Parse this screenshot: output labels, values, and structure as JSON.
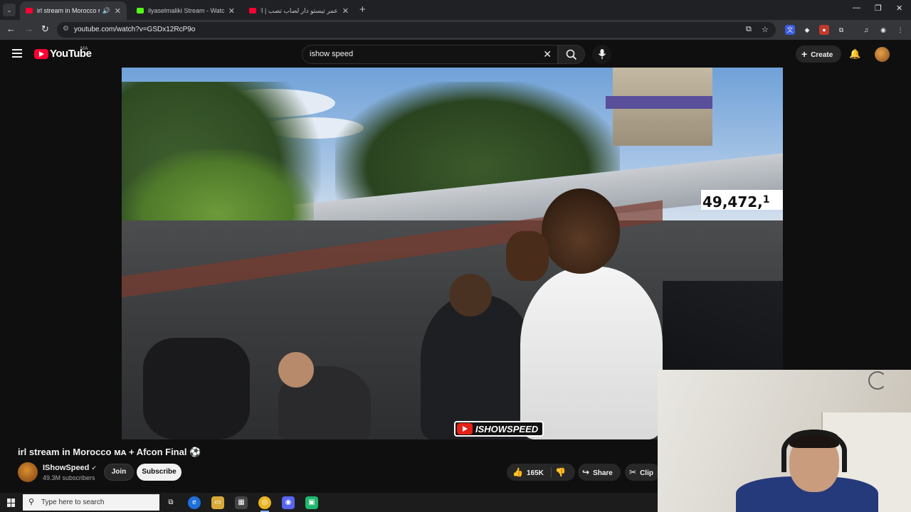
{
  "browser": {
    "tabs": [
      {
        "title": "irl stream in Morocco",
        "flag": "ᴍᴀ",
        "favicon": "youtube-icon",
        "active": true,
        "audio": true
      },
      {
        "title": "ilyaselmaliki Stream - Watch Li",
        "favicon": "kick-icon",
        "active": false
      },
      {
        "title": "عمر تيستو دار لصاب تصب | اليوم",
        "favicon": "youtube-icon",
        "active": false
      }
    ],
    "new_tab": "+",
    "url": "youtube.com/watch?v=GSDx12RcP9o"
  },
  "youtube": {
    "logo_text": "YouTube",
    "country_code": "MA",
    "search_query": "ishow speed",
    "create_label": "Create"
  },
  "video": {
    "overlay_counter": "49,472,",
    "overlay_counter_cut": "1",
    "watermark": "ISHOWSPEED",
    "title": "irl stream in Morocco ᴍᴀ + Afcon Final ⚽",
    "channel_name": "IShowSpeed",
    "subscribers": "49.3M subscribers",
    "join_label": "Join",
    "subscribe_label": "Subscribe",
    "likes": "165K",
    "share_label": "Share",
    "clip_label": "Clip"
  },
  "taskbar": {
    "search_placeholder": "Type here to search"
  },
  "colors": {
    "youtube_red": "#ff0033",
    "kick_green": "#53fc18",
    "page_bg": "#0f0f0f"
  }
}
